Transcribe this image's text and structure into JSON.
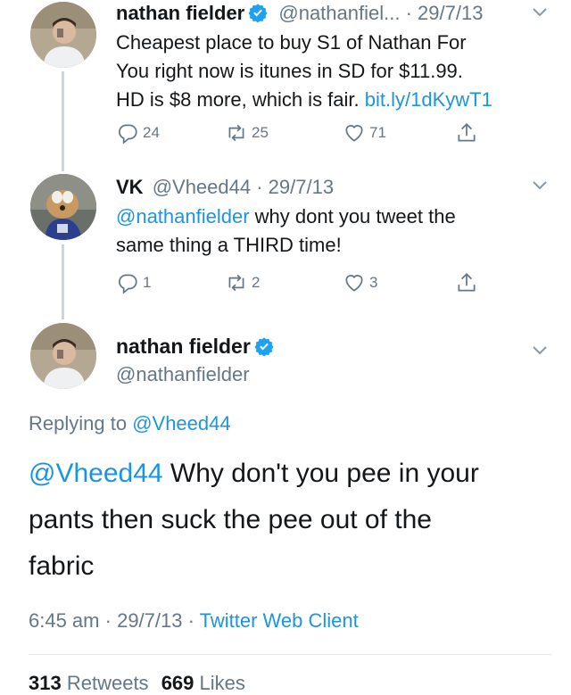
{
  "tweets": [
    {
      "name": "nathan fielder",
      "handle": "@nathanfiel...",
      "date": "· 29/7/13",
      "text_line1": "Cheapest place to buy S1 of Nathan For",
      "text_line2": "You right now is itunes in SD for $11.99.",
      "text_line3_pre": "HD is $8 more, which is fair. ",
      "text_link": "bit.ly/1dKywT1",
      "replies": "24",
      "retweets": "25",
      "likes": "71"
    },
    {
      "name": "VK",
      "handle": "@Vheed44",
      "date": "· 29/7/13",
      "mention": "@nathanfielder",
      "text_after_mention": " why dont you tweet the",
      "text_line2": "same thing a THIRD time!",
      "replies": "1",
      "retweets": "2",
      "likes": "3"
    }
  ],
  "main_tweet": {
    "name": "nathan fielder",
    "handle": "@nathanfielder",
    "replying_prefix": "Replying to ",
    "replying_handle": "@Vheed44",
    "mention": "@Vheed44",
    "text_line1": " Why don't you pee in your",
    "text_line2": "pants then suck the pee out of the",
    "text_line3": "fabric",
    "time": "6:45 am",
    "date": "29/7/13",
    "separator": "·",
    "client": "Twitter Web Client",
    "retweets_count": "313",
    "retweets_label": "Retweets",
    "likes_count": "669",
    "likes_label": "Likes"
  },
  "colors": {
    "link": "#1b95e0",
    "muted": "#657786",
    "verified": "#1da1f2",
    "thread_line": "#ccd6dd"
  },
  "icons": [
    "verified-badge-icon",
    "chevron-down-icon",
    "reply-icon",
    "retweet-icon",
    "like-icon",
    "share-icon"
  ]
}
